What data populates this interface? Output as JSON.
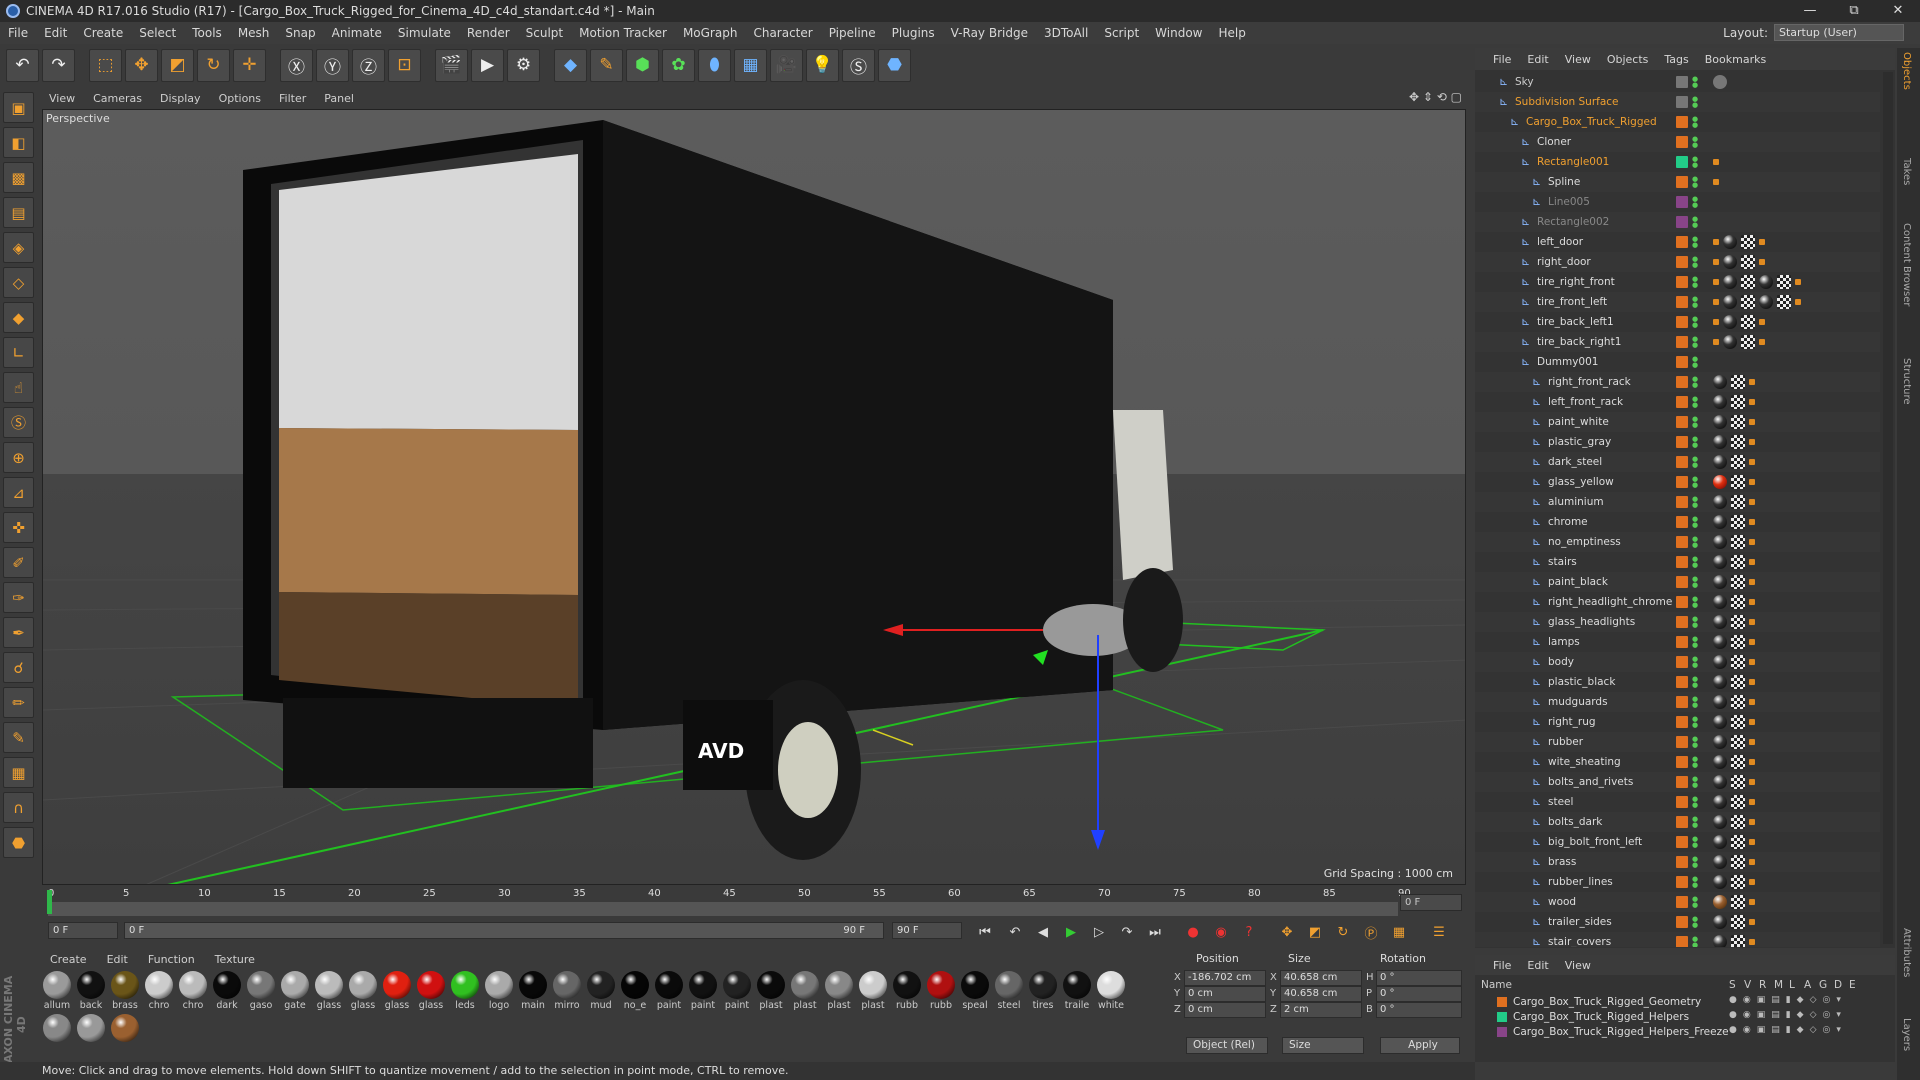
{
  "window": {
    "title": "CINEMA 4D R17.016 Studio (R17) - [Cargo_Box_Truck_Rigged_for_Cinema_4D_c4d_standart.c4d *] - Main",
    "minimize": "—",
    "maximize": "⧉",
    "close": "✕"
  },
  "menubar": {
    "items": [
      "File",
      "Edit",
      "Create",
      "Select",
      "Tools",
      "Mesh",
      "Snap",
      "Animate",
      "Simulate",
      "Render",
      "Sculpt",
      "Motion Tracker",
      "MoGraph",
      "Character",
      "Pipeline",
      "Plugins",
      "V-Ray Bridge",
      "3DToAll",
      "Script",
      "Window",
      "Help"
    ],
    "layout_label": "Layout:",
    "layout_value": "Startup (User)"
  },
  "viewport": {
    "menu": [
      "View",
      "Cameras",
      "Display",
      "Options",
      "Filter",
      "Panel"
    ],
    "label": "Perspective",
    "grid_spacing": "Grid Spacing : 1000 cm",
    "truck_plate": "AVD"
  },
  "timeline": {
    "ticks": [
      "0",
      "5",
      "10",
      "15",
      "20",
      "25",
      "30",
      "35",
      "40",
      "45",
      "50",
      "55",
      "60",
      "65",
      "70",
      "75",
      "80",
      "85",
      "90"
    ],
    "end_frame": "0 F",
    "start_field": "0 F",
    "current_field": "0 F",
    "slider_end": "90 F",
    "max_field": "90 F"
  },
  "materials": {
    "menu": [
      "Create",
      "Edit",
      "Function",
      "Texture"
    ],
    "items": [
      {
        "label": "allum",
        "color": "#9a9a9a"
      },
      {
        "label": "back",
        "color": "#111"
      },
      {
        "label": "brass",
        "color": "#6a5518"
      },
      {
        "label": "chro",
        "color": "#ccc"
      },
      {
        "label": "chro",
        "color": "#bbb"
      },
      {
        "label": "dark",
        "color": "#0a0a0a"
      },
      {
        "label": "gaso",
        "color": "#777"
      },
      {
        "label": "gate",
        "color": "#aaa"
      },
      {
        "label": "glass",
        "color": "#bbb"
      },
      {
        "label": "glass",
        "color": "#aaa"
      },
      {
        "label": "glass",
        "color": "#e02010"
      },
      {
        "label": "glass",
        "color": "#d01010"
      },
      {
        "label": "leds",
        "color": "#30c020"
      },
      {
        "label": "logo",
        "color": "#aaa"
      },
      {
        "label": "main",
        "color": "#080808"
      },
      {
        "label": "mirro",
        "color": "#666"
      },
      {
        "label": "mud",
        "color": "#222"
      },
      {
        "label": "no_e",
        "color": "#050505"
      },
      {
        "label": "paint",
        "color": "#0a0a0a"
      },
      {
        "label": "paint",
        "color": "#111"
      },
      {
        "label": "paint",
        "color": "#222"
      },
      {
        "label": "plast",
        "color": "#0a0a0a"
      },
      {
        "label": "plast",
        "color": "#777"
      },
      {
        "label": "plast",
        "color": "#888"
      },
      {
        "label": "plast",
        "color": "#ccc"
      },
      {
        "label": "rubb",
        "color": "#111"
      },
      {
        "label": "rubb",
        "color": "#b01010"
      },
      {
        "label": "speal",
        "color": "#0a0a0a"
      },
      {
        "label": "steel",
        "color": "#666"
      },
      {
        "label": "tires",
        "color": "#222"
      },
      {
        "label": "traile",
        "color": "#111"
      },
      {
        "label": "white",
        "color": "#ddd"
      },
      {
        "label": "",
        "color": "#888"
      },
      {
        "label": "",
        "color": "#999"
      },
      {
        "label": "",
        "color": "#9a6030"
      }
    ]
  },
  "coords": {
    "headers": {
      "position": "Position",
      "size": "Size",
      "rotation": "Rotation"
    },
    "rows": [
      {
        "axis": "X",
        "pos": "-186.702 cm",
        "saxis": "X",
        "size": "40.658 cm",
        "raxis": "H",
        "rot": "0 °"
      },
      {
        "axis": "Y",
        "pos": "0 cm",
        "saxis": "Y",
        "size": "40.658 cm",
        "raxis": "P",
        "rot": "0 °"
      },
      {
        "axis": "Z",
        "pos": "0 cm",
        "saxis": "Z",
        "size": "2 cm",
        "raxis": "B",
        "rot": "0 °"
      }
    ],
    "mode": "Object (Rel)",
    "size_mode": "Size",
    "apply": "Apply"
  },
  "status": "Move: Click and drag to move elements. Hold down SHIFT to quantize movement / add to the selection in point mode, CTRL to remove.",
  "objects": {
    "menu": [
      "File",
      "Edit",
      "View",
      "Objects",
      "Tags",
      "Bookmarks"
    ],
    "items": [
      {
        "name": "Sky",
        "indent": 0,
        "color": "#ccc",
        "layer": "#777",
        "tags": [
          "sky"
        ]
      },
      {
        "name": "Subdivision Surface",
        "indent": 0,
        "color": "#f0a030",
        "layer": "#777",
        "tags": []
      },
      {
        "name": "Cargo_Box_Truck_Rigged",
        "indent": 1,
        "color": "#f0a030",
        "layer": "#e07020",
        "tags": []
      },
      {
        "name": "Cloner",
        "indent": 2,
        "color": "#ddd",
        "layer": "#e07020",
        "tags": []
      },
      {
        "name": "Rectangle001",
        "indent": 2,
        "color": "#f0a030",
        "layer": "#22cc88",
        "tags": [
          "ph"
        ]
      },
      {
        "name": "Spline",
        "indent": 3,
        "color": "#ddd",
        "layer": "#e07020",
        "tags": [
          "ph"
        ]
      },
      {
        "name": "Line005",
        "indent": 3,
        "color": "#888",
        "layer": "#884488",
        "tags": []
      },
      {
        "name": "Rectangle002",
        "indent": 2,
        "color": "#888",
        "layer": "#884488",
        "tags": []
      },
      {
        "name": "left_door",
        "indent": 2,
        "color": "#ddd",
        "layer": "#e07020",
        "tags": [
          "ph",
          "ball",
          "chk",
          "ph"
        ]
      },
      {
        "name": "right_door",
        "indent": 2,
        "color": "#ddd",
        "layer": "#e07020",
        "tags": [
          "ph",
          "ball",
          "chk",
          "ph"
        ]
      },
      {
        "name": "tire_right_front",
        "indent": 2,
        "color": "#ddd",
        "layer": "#e07020",
        "tags": [
          "ph",
          "ball",
          "chk",
          "ball",
          "chk",
          "ph"
        ]
      },
      {
        "name": "tire_front_left",
        "indent": 2,
        "color": "#ddd",
        "layer": "#e07020",
        "tags": [
          "ph",
          "ball",
          "chk",
          "ball",
          "chk",
          "ph"
        ]
      },
      {
        "name": "tire_back_left1",
        "indent": 2,
        "color": "#ddd",
        "layer": "#e07020",
        "tags": [
          "ph",
          "ball",
          "chk",
          "ph"
        ]
      },
      {
        "name": "tire_back_right1",
        "indent": 2,
        "color": "#ddd",
        "layer": "#e07020",
        "tags": [
          "ph",
          "ball",
          "chk",
          "ph"
        ]
      },
      {
        "name": "Dummy001",
        "indent": 2,
        "color": "#ddd",
        "layer": "#e07020",
        "tags": []
      },
      {
        "name": "right_front_rack",
        "indent": 3,
        "color": "#ddd",
        "layer": "#e07020",
        "tags": [
          "ball",
          "chk",
          "ph"
        ]
      },
      {
        "name": "left_front_rack",
        "indent": 3,
        "color": "#ddd",
        "layer": "#e07020",
        "tags": [
          "ball",
          "chk",
          "ph"
        ]
      },
      {
        "name": "paint_white",
        "indent": 3,
        "color": "#ddd",
        "layer": "#e07020",
        "tags": [
          "ball",
          "chk",
          "ph"
        ]
      },
      {
        "name": "plastic_gray",
        "indent": 3,
        "color": "#ddd",
        "layer": "#e07020",
        "tags": [
          "ball",
          "chk",
          "ph"
        ]
      },
      {
        "name": "dark_steel",
        "indent": 3,
        "color": "#ddd",
        "layer": "#e07020",
        "tags": [
          "ball",
          "chk",
          "ph"
        ]
      },
      {
        "name": "glass_yellow",
        "indent": 3,
        "color": "#ddd",
        "layer": "#e07020",
        "tags": [
          "ballred",
          "chk",
          "ph"
        ]
      },
      {
        "name": "aluminium",
        "indent": 3,
        "color": "#ddd",
        "layer": "#e07020",
        "tags": [
          "ball",
          "chk",
          "ph"
        ]
      },
      {
        "name": "chrome",
        "indent": 3,
        "color": "#ddd",
        "layer": "#e07020",
        "tags": [
          "ball",
          "chk",
          "ph"
        ]
      },
      {
        "name": "no_emptiness",
        "indent": 3,
        "color": "#ddd",
        "layer": "#e07020",
        "tags": [
          "ball",
          "chk",
          "ph"
        ]
      },
      {
        "name": "stairs",
        "indent": 3,
        "color": "#ddd",
        "layer": "#e07020",
        "tags": [
          "ball",
          "chk",
          "ph"
        ]
      },
      {
        "name": "paint_black",
        "indent": 3,
        "color": "#ddd",
        "layer": "#e07020",
        "tags": [
          "ball",
          "chk",
          "ph"
        ]
      },
      {
        "name": "right_headlight_chrome",
        "indent": 3,
        "color": "#ddd",
        "layer": "#e07020",
        "tags": [
          "ball",
          "chk",
          "ph"
        ]
      },
      {
        "name": "glass_headlights",
        "indent": 3,
        "color": "#ddd",
        "layer": "#e07020",
        "tags": [
          "ball",
          "chk",
          "ph"
        ]
      },
      {
        "name": "lamps",
        "indent": 3,
        "color": "#ddd",
        "layer": "#e07020",
        "tags": [
          "ball",
          "chk",
          "ph"
        ]
      },
      {
        "name": "body",
        "indent": 3,
        "color": "#ddd",
        "layer": "#e07020",
        "tags": [
          "ball",
          "chk",
          "ph"
        ]
      },
      {
        "name": "plastic_black",
        "indent": 3,
        "color": "#ddd",
        "layer": "#e07020",
        "tags": [
          "ball",
          "chk",
          "ph"
        ]
      },
      {
        "name": "mudguards",
        "indent": 3,
        "color": "#ddd",
        "layer": "#e07020",
        "tags": [
          "ball",
          "chk",
          "ph"
        ]
      },
      {
        "name": "right_rug",
        "indent": 3,
        "color": "#ddd",
        "layer": "#e07020",
        "tags": [
          "ball",
          "chk",
          "ph"
        ]
      },
      {
        "name": "rubber",
        "indent": 3,
        "color": "#ddd",
        "layer": "#e07020",
        "tags": [
          "ball",
          "chk",
          "ph"
        ]
      },
      {
        "name": "wite_sheating",
        "indent": 3,
        "color": "#ddd",
        "layer": "#e07020",
        "tags": [
          "ball",
          "chk",
          "ph"
        ]
      },
      {
        "name": "bolts_and_rivets",
        "indent": 3,
        "color": "#ddd",
        "layer": "#e07020",
        "tags": [
          "ball",
          "chk",
          "ph"
        ]
      },
      {
        "name": "steel",
        "indent": 3,
        "color": "#ddd",
        "layer": "#e07020",
        "tags": [
          "ball",
          "chk",
          "ph"
        ]
      },
      {
        "name": "bolts_dark",
        "indent": 3,
        "color": "#ddd",
        "layer": "#e07020",
        "tags": [
          "ball",
          "chk",
          "ph"
        ]
      },
      {
        "name": "big_bolt_front_left",
        "indent": 3,
        "color": "#ddd",
        "layer": "#e07020",
        "tags": [
          "ball",
          "chk",
          "ph"
        ]
      },
      {
        "name": "brass",
        "indent": 3,
        "color": "#ddd",
        "layer": "#e07020",
        "tags": [
          "ball",
          "chk",
          "ph"
        ]
      },
      {
        "name": "rubber_lines",
        "indent": 3,
        "color": "#ddd",
        "layer": "#e07020",
        "tags": [
          "ball",
          "chk",
          "ph"
        ]
      },
      {
        "name": "wood",
        "indent": 3,
        "color": "#ddd",
        "layer": "#e07020",
        "tags": [
          "ballwood",
          "chk",
          "ph"
        ]
      },
      {
        "name": "trailer_sides",
        "indent": 3,
        "color": "#ddd",
        "layer": "#e07020",
        "tags": [
          "ball",
          "chk",
          "ph"
        ]
      },
      {
        "name": "stair_covers",
        "indent": 3,
        "color": "#ddd",
        "layer": "#e07020",
        "tags": [
          "ball",
          "chk",
          "ph"
        ]
      }
    ]
  },
  "layers": {
    "menu": [
      "File",
      "Edit",
      "View"
    ],
    "header": {
      "name": "Name",
      "cols": [
        "S",
        "V",
        "R",
        "M",
        "L",
        "A",
        "G",
        "D",
        "E"
      ]
    },
    "items": [
      {
        "name": "Cargo_Box_Truck_Rigged_Geometry",
        "color": "#e07020"
      },
      {
        "name": "Cargo_Box_Truck_Rigged_Helpers",
        "color": "#22cc88"
      },
      {
        "name": "Cargo_Box_Truck_Rigged_Helpers_Freeze",
        "color": "#884488"
      }
    ]
  },
  "sidetabs": [
    "Objects",
    "Takes",
    "Content Browser",
    "Structure",
    "Attributes",
    "Layers"
  ],
  "colors": {
    "accent": "#f0a030",
    "selected_obj": "#f0a030"
  }
}
